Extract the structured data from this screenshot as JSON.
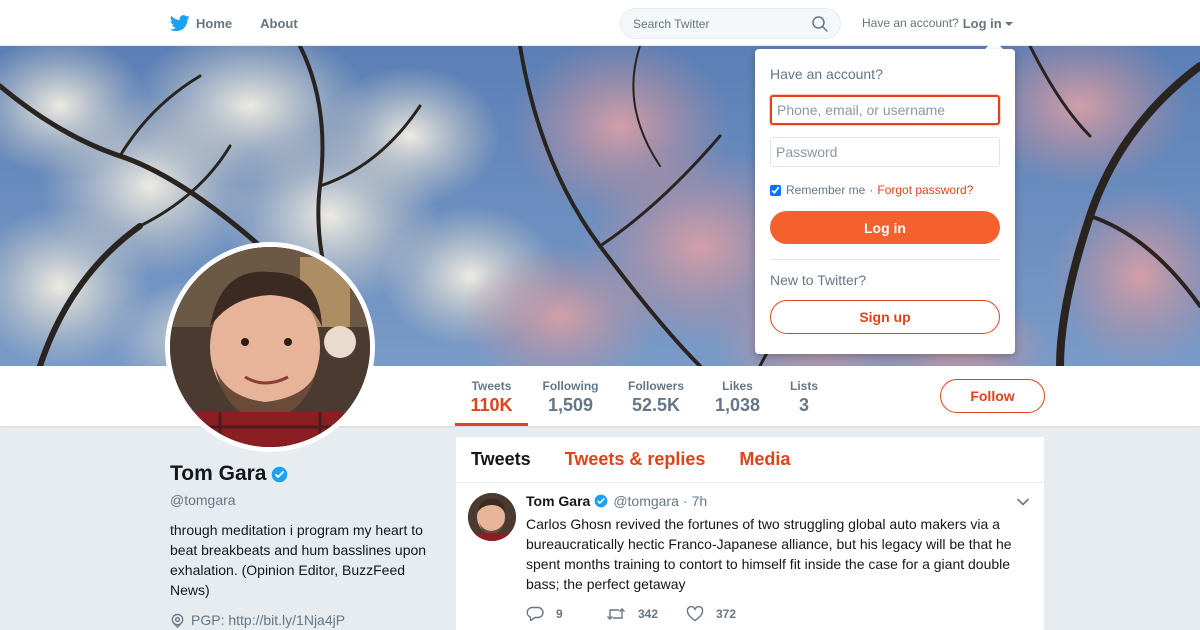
{
  "nav": {
    "home_label": "Home",
    "about_label": "About",
    "search_placeholder": "Search Twitter",
    "have_account_label": "Have an account?",
    "login_label": "Log in"
  },
  "profile": {
    "name": "Tom Gara",
    "handle": "@tomgara",
    "bio": "through meditation i program my heart to beat breakbeats and hum basslines upon exhalation. (Opinion Editor, BuzzFeed News)",
    "pgp": "PGP: http://bit.ly/1Nja4jP"
  },
  "stats": [
    {
      "label": "Tweets",
      "value": "110K"
    },
    {
      "label": "Following",
      "value": "1,509"
    },
    {
      "label": "Followers",
      "value": "52.5K"
    },
    {
      "label": "Likes",
      "value": "1,038"
    },
    {
      "label": "Lists",
      "value": "3"
    }
  ],
  "follow_label": "Follow",
  "timeline": {
    "tabs": [
      "Tweets",
      "Tweets & replies",
      "Media"
    ],
    "active_tab": "Tweets",
    "tweet": {
      "name": "Tom Gara",
      "handle": "@tomgara",
      "separator": "·",
      "time": "7h",
      "text": "Carlos Ghosn revived the fortunes of two struggling global auto makers via a bureaucratically hectic Franco-Japanese alliance, but his legacy will be that he spent months training to contort to himself fit inside the case for a giant double bass; the perfect getaway",
      "replies": "9",
      "retweets": "342",
      "likes": "372"
    }
  },
  "login_dropdown": {
    "title": "Have an account?",
    "username_placeholder": "Phone, email, or username",
    "password_placeholder": "Password",
    "remember_label": "Remember me",
    "separator": "·",
    "forgot_label": "Forgot password?",
    "login_button": "Log in",
    "new_label": "New to Twitter?",
    "signup_button": "Sign up",
    "remember_checked": true
  },
  "colors": {
    "accent": "#e0431a",
    "login_button": "#f4612f",
    "twitter_blue": "#1da1f2",
    "background": "#e6ecf0"
  },
  "icons": [
    "twitter-bird-icon",
    "search-icon",
    "caret-down-icon",
    "verified-badge-icon",
    "location-pin-icon",
    "chevron-down-icon",
    "reply-icon",
    "retweet-icon",
    "like-icon"
  ]
}
